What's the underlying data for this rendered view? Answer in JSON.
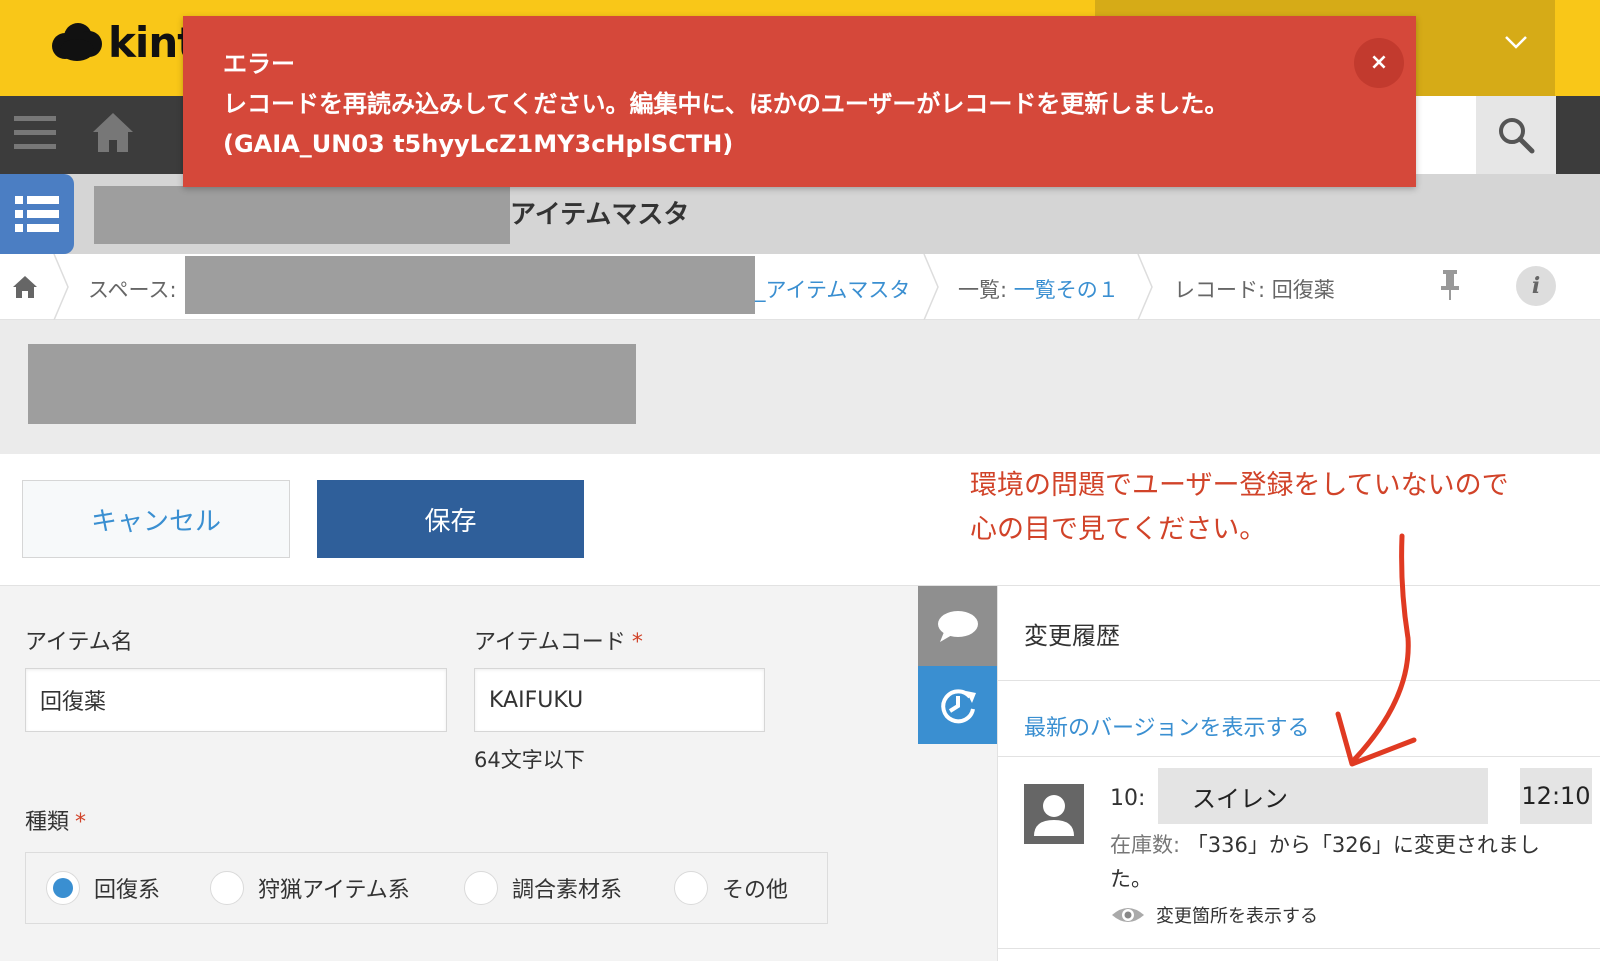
{
  "brand": {
    "logo_text": "kint"
  },
  "toast": {
    "title": "エラー",
    "message": "レコードを再読み込みしてください。編集中に、ほかのユーザーがレコードを更新しました。",
    "code": "(GAIA_UN03 t5hyyLcZ1MY3cHplSCTH)",
    "close_label": "×"
  },
  "app": {
    "title": "アイテムマスタ"
  },
  "breadcrumb": {
    "space_label": "スペース: ",
    "app_link": "_アイテムマスタ",
    "list_label": "一覧: ",
    "list_link": "一覧その１",
    "record_label": "レコード: 回復薬"
  },
  "actions": {
    "cancel_label": "キャンセル",
    "save_label": "保存"
  },
  "annotation": {
    "line1": "環境の問題でユーザー登録をしていないので",
    "line2": "心の目で見てください。"
  },
  "form": {
    "item_name": {
      "label": "アイテム名",
      "value": "回復薬"
    },
    "item_code": {
      "label": "アイテムコード",
      "required": "*",
      "value": "KAIFUKU",
      "hint": "64文字以下"
    },
    "category": {
      "label": "種類",
      "required": "*",
      "options": [
        "回復系",
        "狩猟アイテム系",
        "調合素材系",
        "その他"
      ],
      "selected": "回復系"
    }
  },
  "history": {
    "title": "変更履歴",
    "latest_link": "最新のバージョンを表示する",
    "entry": {
      "version": "10:",
      "user": "スイレン",
      "time": "12:10",
      "field": "在庫数:",
      "change_text": "「336」から「326」に変更されました。",
      "diff_link": "変更箇所を表示する"
    }
  },
  "colors": {
    "accent": "#3a8fd1",
    "error": "#d5483a",
    "brand_yellow": "#f9c718",
    "save_button": "#2f5f9a"
  }
}
